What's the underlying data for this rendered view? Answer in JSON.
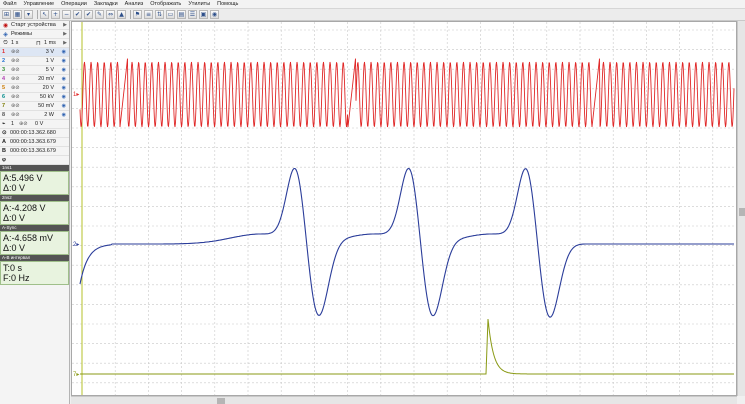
{
  "menu": [
    "Файл",
    "Управление",
    "Операции",
    "Закладки",
    "Анализ",
    "Отображать",
    "Утилиты",
    "Помощь"
  ],
  "sidebar": {
    "start_device": "Старт устройства",
    "modes": "Режимы",
    "timebase": "1 s",
    "sample_interval": "1 ms",
    "channels": [
      {
        "num": "1",
        "value": "3 V",
        "color": "#e03030"
      },
      {
        "num": "2",
        "value": "1 V",
        "color": "#1f6fd0"
      },
      {
        "num": "3",
        "value": "5 V",
        "color": "#2e8b2e"
      },
      {
        "num": "4",
        "value": "20 mV",
        "color": "#b23fb2"
      },
      {
        "num": "5",
        "value": "20 V",
        "color": "#cc7a00"
      },
      {
        "num": "6",
        "value": "50 kV",
        "color": "#008b8b"
      },
      {
        "num": "7",
        "value": "50 mV",
        "color": "#7a7a00"
      },
      {
        "num": "8",
        "value": "2 W",
        "color": "#555555"
      }
    ],
    "trigger_num": "1",
    "trigger_value": "0 V",
    "cursor_time": "000:00:13.362.680",
    "cursor_a_label": "A",
    "cursor_a": "000:00:13.363.679",
    "cursor_b_label": "B",
    "cursor_b": "000:00:13.363.679",
    "phi": "φ"
  },
  "measurements": [
    {
      "header": "1ns1",
      "a": "A:5.496 V",
      "d": "Δ:0 V"
    },
    {
      "header": "2ns2",
      "a": "A:-4.208 V",
      "d": "Δ:0 V"
    },
    {
      "header": "A-Sync",
      "a": "A:-4.658 mV",
      "d": "Δ:0 V"
    },
    {
      "header": "A-B интервал",
      "a": "T:0 s",
      "d": "F:0 Hz"
    }
  ],
  "plot": {
    "channel_markers": [
      "1",
      "2",
      "7"
    ],
    "colors": {
      "red": "#e02828",
      "blue": "#2b3d9a",
      "olive": "#8a9a14",
      "grid": "#c8c8c8",
      "cursor": "#b6c22a"
    }
  },
  "icons": [
    "start-icon",
    "modes-icon",
    "eye-icon",
    "cursor-icon"
  ]
}
